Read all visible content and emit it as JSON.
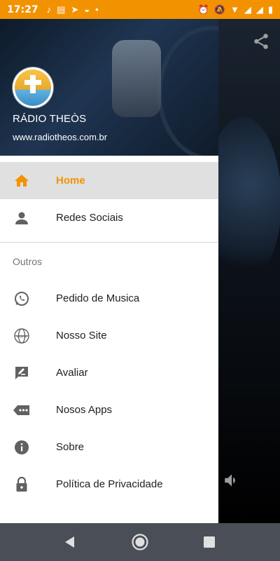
{
  "status_bar": {
    "time": "17:27"
  },
  "header": {
    "station_name": "RÁDIO THEÒS",
    "website": "www.radiotheos.com.br"
  },
  "menu": {
    "primary": [
      {
        "label": "Home",
        "icon": "home-icon",
        "active": true
      },
      {
        "label": "Redes Sociais",
        "icon": "person-icon",
        "active": false
      }
    ],
    "section_title": "Outros",
    "secondary": [
      {
        "label": "Pedido de Musica",
        "icon": "whatsapp-icon"
      },
      {
        "label": "Nosso Site",
        "icon": "globe-icon"
      },
      {
        "label": "Avaliar",
        "icon": "rate-review-icon"
      },
      {
        "label": "Nosos Apps",
        "icon": "apps-tag-icon"
      },
      {
        "label": "Sobre",
        "icon": "info-icon"
      },
      {
        "label": "Política de Privacidade",
        "icon": "lock-icon"
      }
    ]
  },
  "colors": {
    "accent": "#F39200",
    "icon_gray": "#616161",
    "navbar": "#4a4f57"
  }
}
